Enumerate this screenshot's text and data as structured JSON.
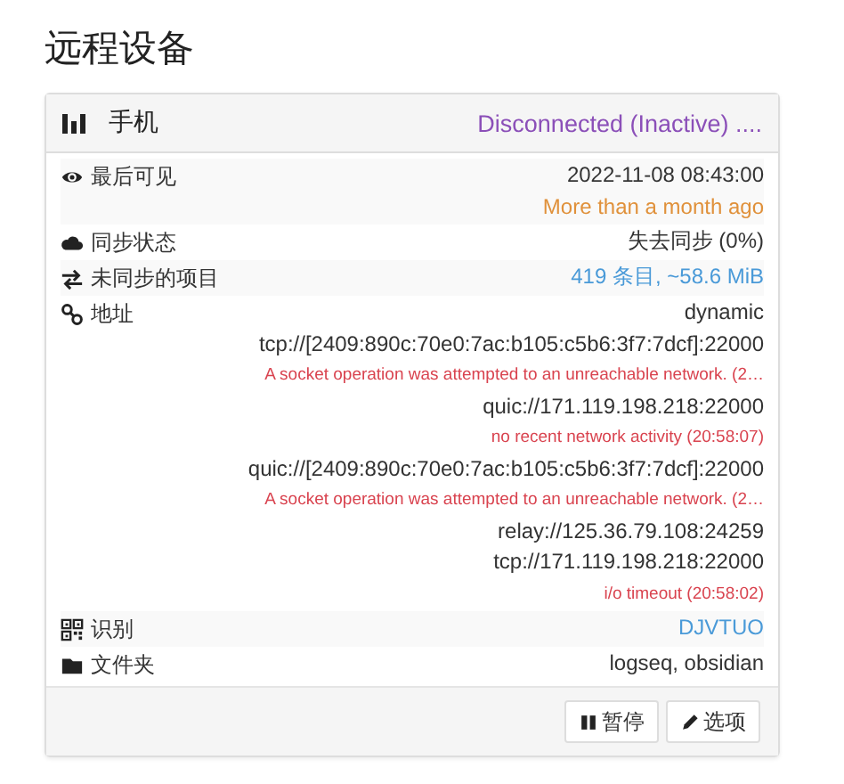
{
  "title": "远程设备",
  "device": {
    "name": "手机",
    "status": "Disconnected (Inactive) ...."
  },
  "rows": [
    {
      "kind": "eye",
      "label": "最后可见",
      "values": [
        {
          "text": "2022-11-08 08:43:00",
          "kind": "plain"
        },
        {
          "text": "More than a month ago",
          "kind": "warning"
        }
      ]
    },
    {
      "kind": "cloud",
      "label": "同步状态",
      "values": [
        {
          "text": "失去同步 (0%)",
          "kind": "plain"
        }
      ]
    },
    {
      "kind": "arrows",
      "label": "未同步的项目",
      "values": [
        {
          "text": "419 条目, ~58.6 MiB",
          "kind": "link"
        }
      ]
    },
    {
      "kind": "link",
      "label": "地址",
      "values": [
        {
          "text": "dynamic",
          "kind": "plain"
        },
        {
          "text": "tcp://[2409:890c:70e0:7ac:b105:c5b6:3f7:7dcf]:22000",
          "kind": "plain"
        },
        {
          "text": "A socket operation was attempted to an unreachable network. (2…",
          "kind": "error"
        },
        {
          "text": "quic://171.119.198.218:22000",
          "kind": "plain"
        },
        {
          "text": "no recent network activity (20:58:07)",
          "kind": "error"
        },
        {
          "text": "quic://[2409:890c:70e0:7ac:b105:c5b6:3f7:7dcf]:22000",
          "kind": "plain"
        },
        {
          "text": "A socket operation was attempted to an unreachable network. (2…",
          "kind": "error"
        },
        {
          "text": "relay://125.36.79.108:24259",
          "kind": "plain"
        },
        {
          "text": "tcp://171.119.198.218:22000",
          "kind": "plain"
        },
        {
          "text": "i/o timeout (20:58:02)",
          "kind": "error"
        }
      ]
    },
    {
      "kind": "qr",
      "label": "识别",
      "values": [
        {
          "text": "DJVTUO",
          "kind": "link"
        }
      ]
    },
    {
      "kind": "folder",
      "label": "文件夹",
      "values": [
        {
          "text": "logseq, obsidian",
          "kind": "plain"
        }
      ]
    }
  ],
  "buttons": [
    {
      "kind": "pause",
      "label": "暂停"
    },
    {
      "kind": "pencil",
      "label": "选项"
    }
  ]
}
